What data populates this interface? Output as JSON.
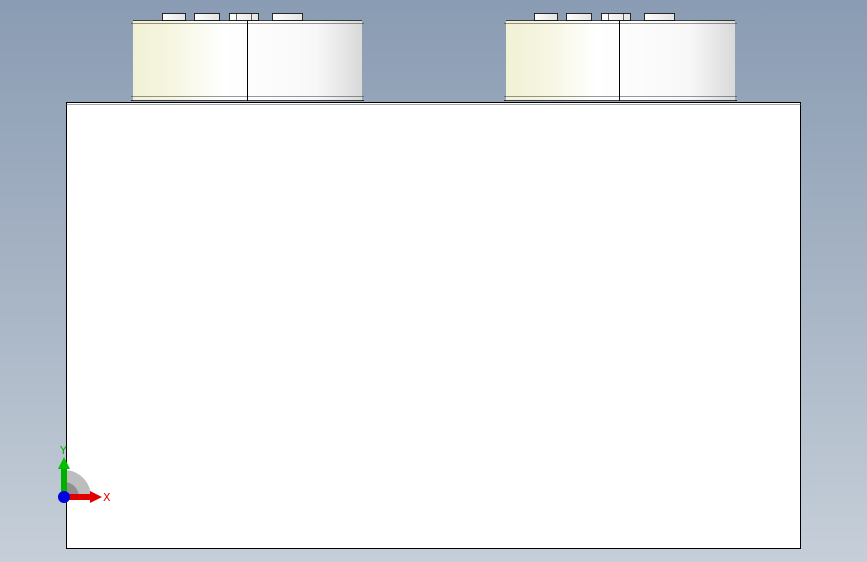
{
  "viewport": {
    "background_top": "#8a9cb3",
    "background_bottom": "#c6cfd9"
  },
  "model": {
    "base_block_color": "#ffffff",
    "base_block_edge_color": "#000000",
    "cylinder_color_light": "#ffffff",
    "cylinder_color_warm": "#f3f3d8",
    "cylinder_color_shade": "#d6d6d6"
  },
  "triad": {
    "x_label": "X",
    "y_label": "Y",
    "x_color": "#e00000",
    "y_color": "#00b000",
    "z_color": "#0000e0"
  }
}
